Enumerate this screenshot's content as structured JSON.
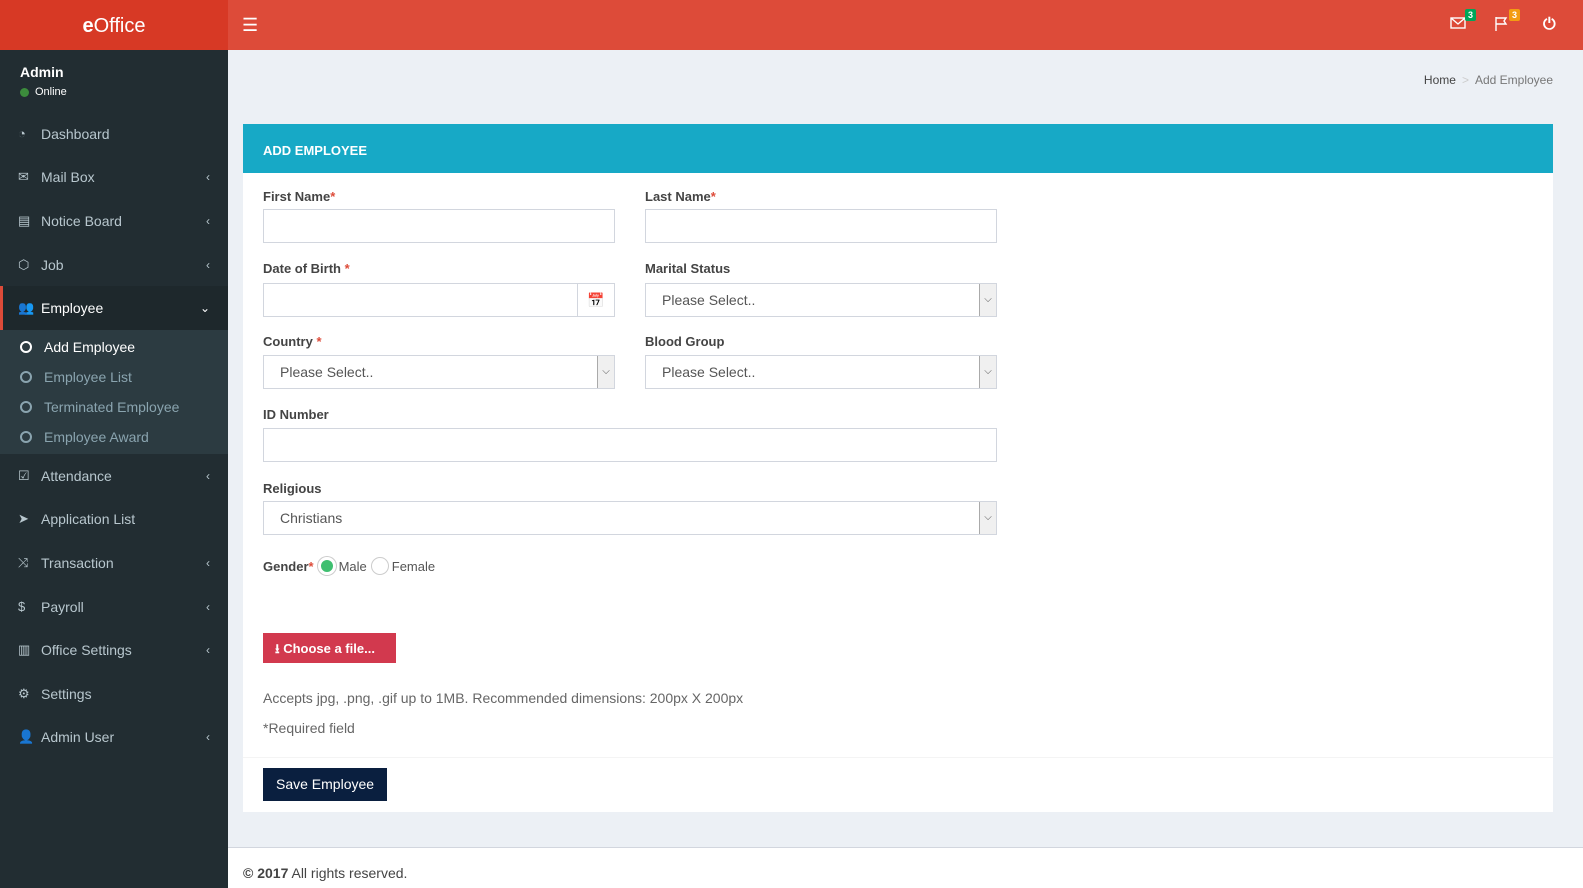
{
  "app": {
    "logo_bold": "e",
    "logo_rest": "Office"
  },
  "header": {
    "mail_count": "3",
    "flag_count": "3",
    "colors": {
      "header": "#dd4b39",
      "mail_badge": "#00a65a",
      "flag_badge": "#f39c12"
    }
  },
  "user": {
    "name": "Admin",
    "status": "Online"
  },
  "sidebar": {
    "items": [
      {
        "label": "Dashboard",
        "icon": "dashboard-icon"
      },
      {
        "label": "Mail Box",
        "icon": "envelope-icon",
        "chev": "‹"
      },
      {
        "label": "Notice Board",
        "icon": "newspaper-icon",
        "chev": "‹"
      },
      {
        "label": "Job",
        "icon": "cube-icon",
        "chev": "‹"
      },
      {
        "label": "Employee",
        "icon": "users-icon",
        "chev": "⌄"
      },
      {
        "label": "Attendance",
        "icon": "check-square-icon",
        "chev": "‹"
      },
      {
        "label": "Application List",
        "icon": "paper-plane-icon"
      },
      {
        "label": "Transaction",
        "icon": "random-icon",
        "chev": "‹"
      },
      {
        "label": "Payroll",
        "icon": "dollar-icon",
        "chev": "‹"
      },
      {
        "label": "Office Settings",
        "icon": "building-icon",
        "chev": "‹"
      },
      {
        "label": "Settings",
        "icon": "cogs-icon"
      },
      {
        "label": "Admin User",
        "icon": "user-icon",
        "chev": "‹"
      }
    ],
    "employee_sub": [
      "Add Employee",
      "Employee List",
      "Terminated Employee",
      "Employee Award"
    ]
  },
  "breadcrumb": {
    "home": "Home",
    "current": "Add Employee"
  },
  "form": {
    "title": "ADD EMPLOYEE",
    "first_name": "First Name",
    "last_name": "Last Name",
    "dob": "Date of Birth",
    "marital": "Marital Status",
    "marital_value": "Please Select..",
    "country": "Country",
    "country_value": "Please Select..",
    "blood": "Blood Group",
    "blood_value": "Please Select..",
    "id_number": "ID Number",
    "religious": "Religious",
    "religious_value": "Christians",
    "gender": "Gender",
    "male": "Male",
    "female": "Female",
    "choose_file": "Choose a file...",
    "accepts": "Accepts jpg, .png, .gif up to 1MB. Recommended dimensions: 200px X 200px",
    "required_note": "*Required field",
    "save": "Save Employee",
    "star": "*"
  },
  "footer": {
    "year": "© 2017",
    "text": "All rights reserved."
  }
}
